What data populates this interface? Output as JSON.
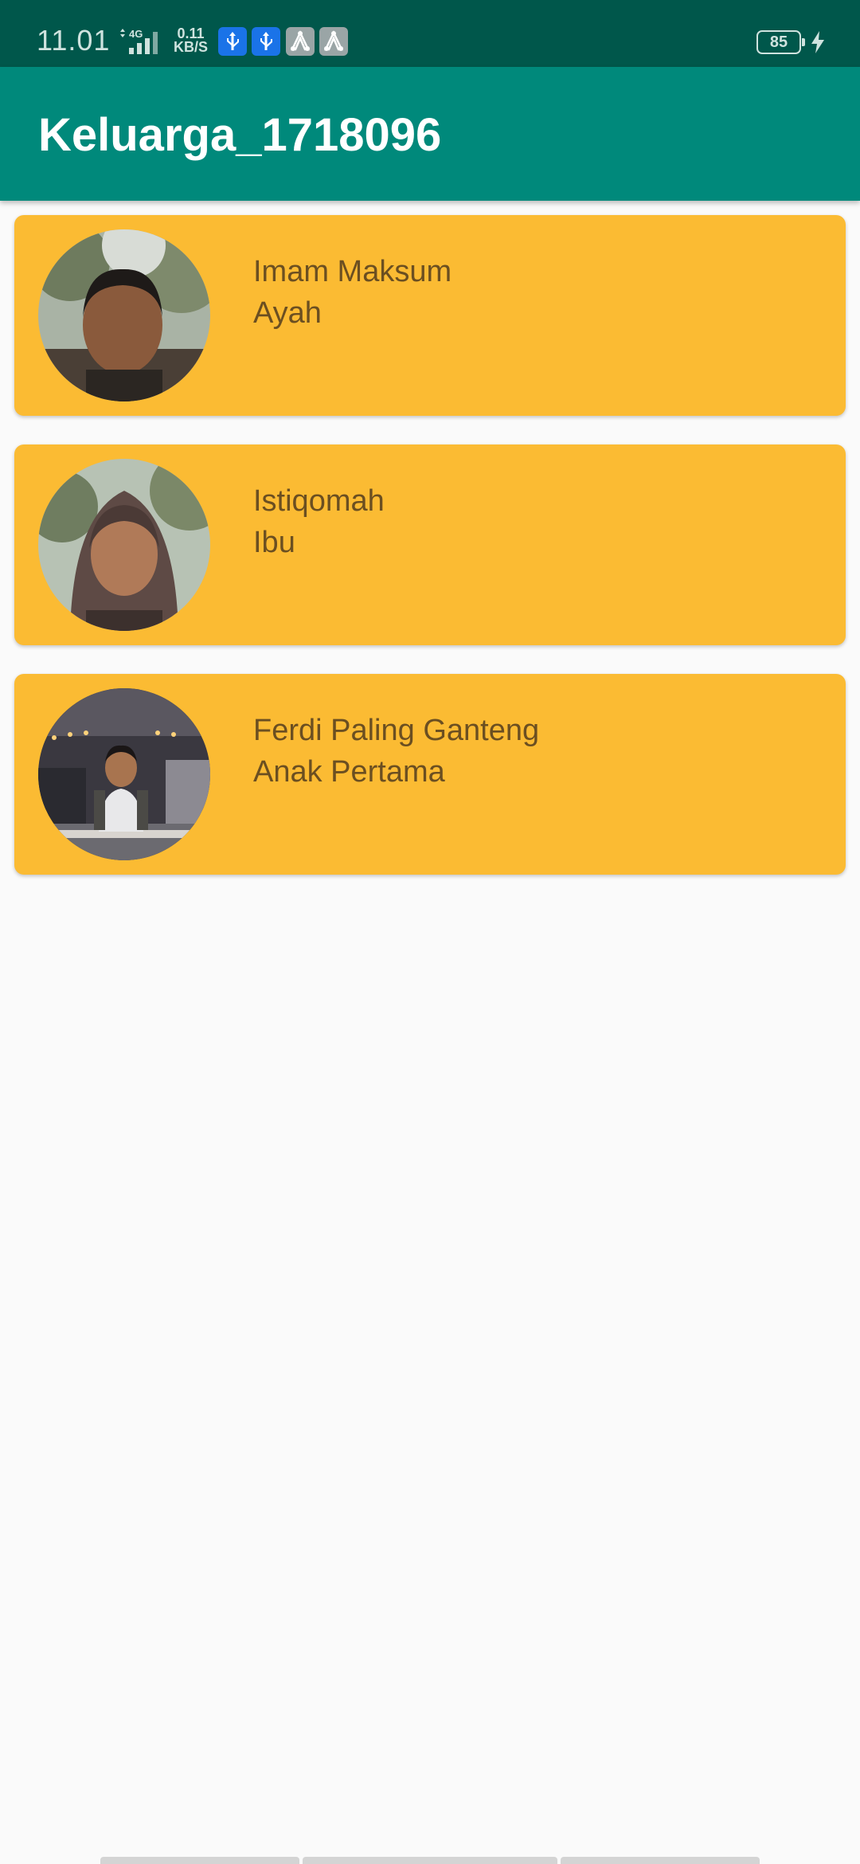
{
  "status_bar": {
    "time": "11.01",
    "network": "4G",
    "speed_value": "0.11",
    "speed_unit": "KB/S",
    "battery": "85",
    "notification_icons": [
      "usb-icon",
      "usb-icon",
      "a-icon",
      "a-icon"
    ]
  },
  "app_bar": {
    "title": "Keluarga_1718096"
  },
  "family": [
    {
      "name": "Imam Maksum",
      "role": "Ayah",
      "avatar": "photo-father"
    },
    {
      "name": "Istiqomah",
      "role": "Ibu",
      "avatar": "photo-mother"
    },
    {
      "name": "Ferdi Paling Ganteng",
      "role": "Anak Pertama",
      "avatar": "photo-son"
    }
  ],
  "colors": {
    "status_bar": "#00574b",
    "app_bar": "#00897b",
    "card": "#fbbb33",
    "card_text": "#6b4f21",
    "background": "#fafafa"
  }
}
